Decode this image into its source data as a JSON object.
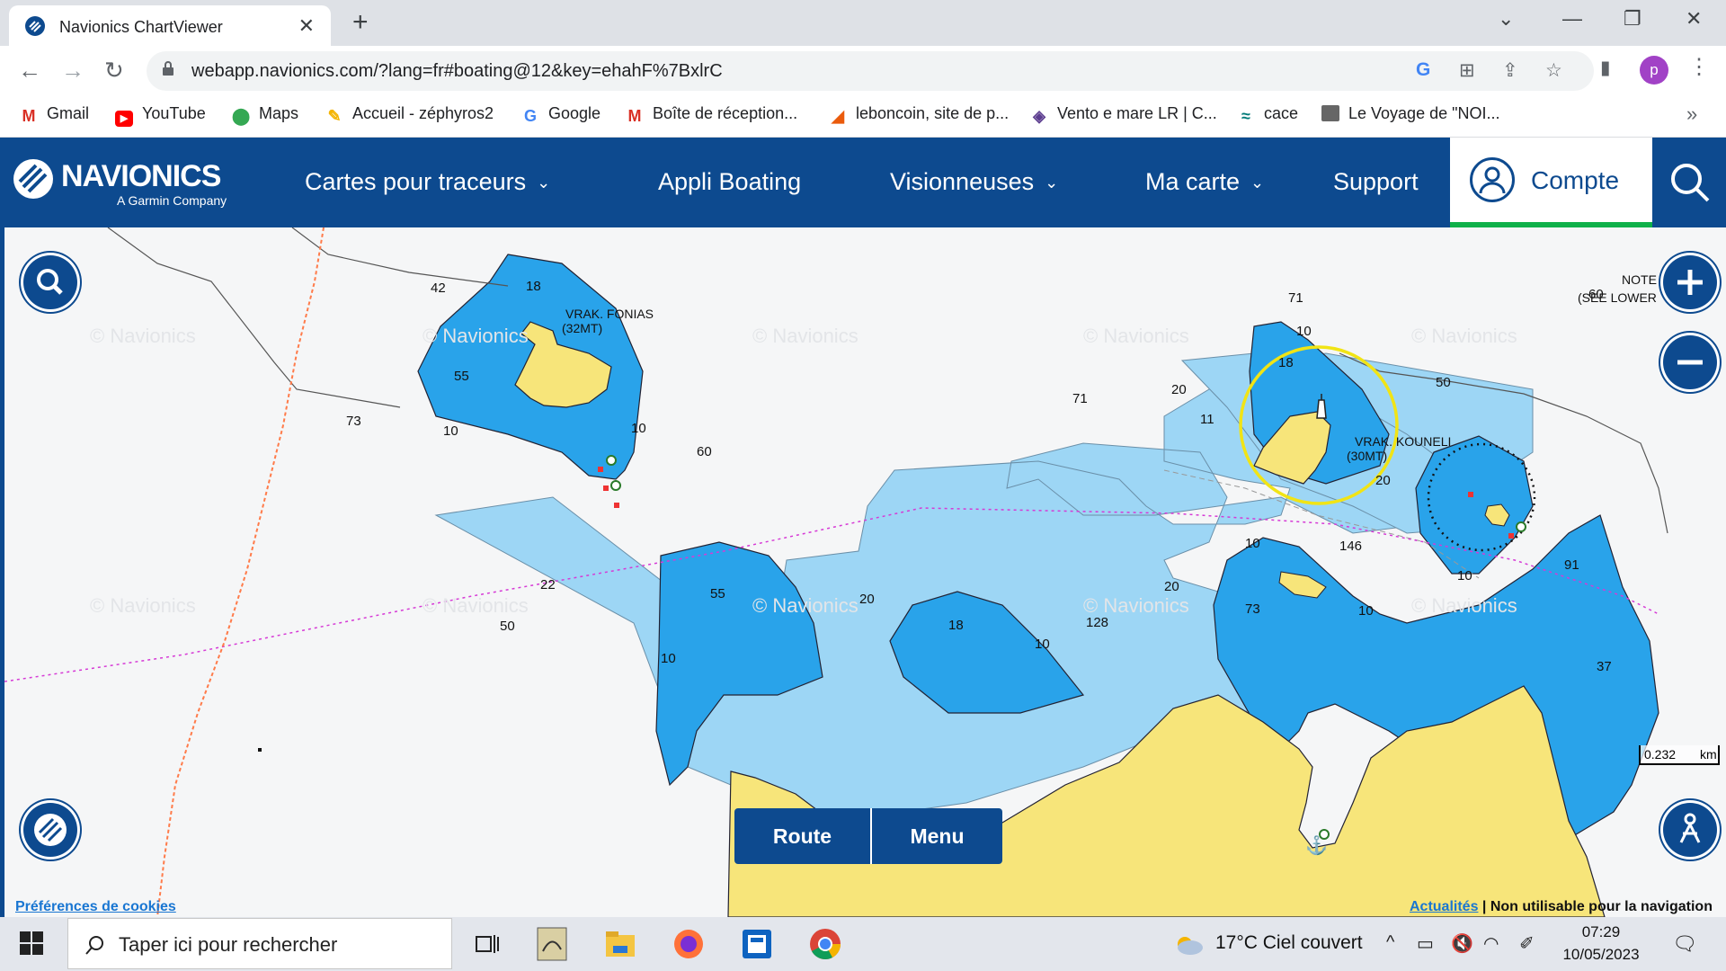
{
  "browser": {
    "tab_title": "Navionics ChartViewer",
    "tab_close": "✕",
    "new_tab": "+",
    "url": "webapp.navionics.com/?lang=fr#boating@12&key=ehahF%7BxlrC",
    "profile_initial": "p",
    "bookmarks": [
      {
        "label": "Gmail",
        "icon": "gmail-icon"
      },
      {
        "label": "YouTube",
        "icon": "youtube-icon"
      },
      {
        "label": "Maps",
        "icon": "maps-icon"
      },
      {
        "label": "Accueil - zéphyros2",
        "icon": "pencil-icon"
      },
      {
        "label": "Google",
        "icon": "google-icon"
      },
      {
        "label": "Boîte de réception...",
        "icon": "gmail-icon"
      },
      {
        "label": "leboncoin, site de p...",
        "icon": "leboncoin-icon"
      },
      {
        "label": "Vento e mare LR | C...",
        "icon": "vento-icon"
      },
      {
        "label": "cace",
        "icon": "credit-agricole-icon"
      },
      {
        "label": "Le Voyage de \"NOI...",
        "icon": "photo-icon"
      }
    ]
  },
  "header": {
    "brand": "NAVIONICS",
    "brand_sub": "A Garmin Company",
    "menu": [
      {
        "label": "Cartes pour traceurs",
        "dropdown": true
      },
      {
        "label": "Appli Boating",
        "dropdown": false
      },
      {
        "label": "Visionneuses",
        "dropdown": true
      },
      {
        "label": "Ma carte",
        "dropdown": true
      },
      {
        "label": "Support",
        "dropdown": false
      }
    ],
    "account_label": "Compte",
    "colors": {
      "primary": "#0d4a8f",
      "accent": "#0fb04a"
    }
  },
  "map": {
    "watermark": "© Navionics",
    "place_names": {
      "fonias": "VRAK. FONIAS",
      "fonias_height": "(32MT)",
      "kouneli": "VRAK. KOUNELI",
      "kouneli_height": "(30MT)"
    },
    "note": [
      "NOTE",
      "(SEE LOWER"
    ],
    "soundings": {
      "s42": "42",
      "s1_8a": "18",
      "s5_5a": "55",
      "s73": "73",
      "s10a": "10",
      "s10b": "10",
      "s60a": "60",
      "s22": "22",
      "s50a": "50",
      "s10c": "10",
      "s5_5b": "55",
      "s20a": "20",
      "s1_8b": "18",
      "s10d": "10",
      "s12_8": "128",
      "s20b": "20",
      "s7_3": "73",
      "s10e": "10",
      "s71a": "71",
      "s71b": "71",
      "s10f": "10",
      "s1_8c": "18",
      "s20c": "20",
      "s11": "11",
      "s50b": "50",
      "s60b": "60",
      "s20d": "20",
      "s10g": "10",
      "s14_6": "146",
      "s10h": "10",
      "s9_1": "91",
      "s3_7": "37"
    },
    "route_label": "Route",
    "menu_label": "Menu",
    "cookies_link": "Préférences de cookies",
    "news_link": "Actualités",
    "disclaimer": " | Non utilisable pour la navigation",
    "scale_value": "0.232",
    "scale_unit": "km",
    "colors": {
      "land": "#f7e57a",
      "shallow": "#29a3ea",
      "medium": "#9dd6f5",
      "deep": "#f5f6f7"
    }
  },
  "taskbar": {
    "search_placeholder": "Taper ici pour rechercher",
    "weather": "17°C  Ciel couvert",
    "time": "07:29",
    "date": "10/05/2023"
  }
}
